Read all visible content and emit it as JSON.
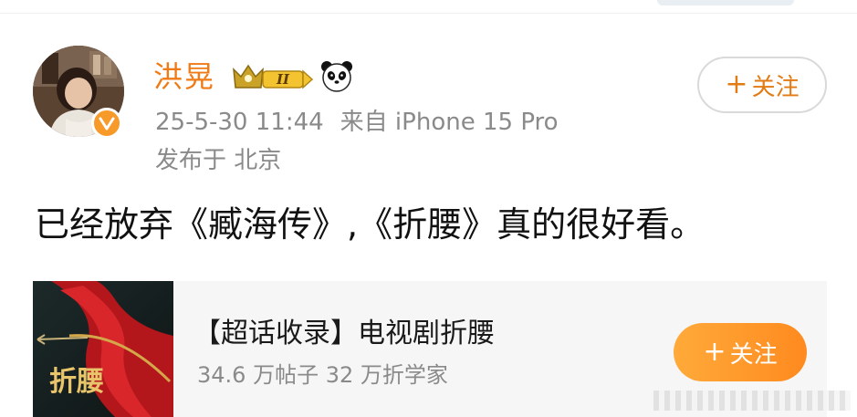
{
  "post": {
    "username": "洪晃",
    "vip_level": "II",
    "timestamp": "25-5-30 11:44",
    "source": "来自 iPhone 15 Pro",
    "location": "发布于 北京",
    "follow_label": "关注",
    "follow_plus": "+",
    "text": "已经放弃《臧海传》,《折腰》真的很好看。"
  },
  "topic_card": {
    "title": "【超话收录】电视剧折腰",
    "stats": "34.6 万帖子 32 万折学家",
    "follow_label": "关注",
    "follow_plus": "+",
    "thumb_text": "折腰"
  },
  "icons": {
    "avatar": "user-avatar",
    "verified": "verified-badge-icon",
    "vip": "vip-crown-badge-icon",
    "panda": "panda-icon"
  },
  "colors": {
    "username": "#f07a16",
    "accent": "#ff8a1f",
    "meta": "#8a8a8a",
    "card_bg": "#f6f6f6"
  }
}
